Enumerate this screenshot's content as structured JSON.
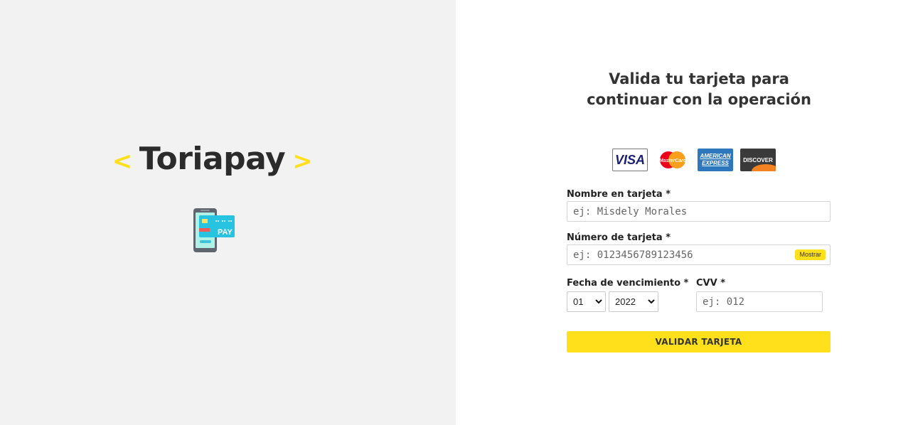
{
  "brand": {
    "left_bracket": "<",
    "name": "Toriapay",
    "right_bracket": ">",
    "accent_color": "#ffe01b",
    "icon_text": "PAY"
  },
  "card_form": {
    "title": "Valida tu tarjeta para continuar con la operación",
    "card_logos": [
      {
        "icon": "visa-logo",
        "text": "VISA"
      },
      {
        "icon": "mastercard-logo",
        "text": "MasterCard"
      },
      {
        "icon": "amex-logo",
        "text_line1": "AMERICAN",
        "text_line2": "EXPRESS"
      },
      {
        "icon": "discover-logo",
        "text": "DISCOVER"
      }
    ],
    "name_label": "Nombre en tarjeta *",
    "name_placeholder": "ej: Misdely Morales",
    "number_label": "Número de tarjeta *",
    "number_placeholder": "ej: 0123456789123456",
    "show_button": "Mostrar",
    "expiry_label": "Fecha de vencimiento *",
    "month_value": "01",
    "year_value": "2022",
    "cvv_label": "CVV *",
    "cvv_placeholder": "ej: 012",
    "submit_label": "VALIDAR TARJETA"
  }
}
